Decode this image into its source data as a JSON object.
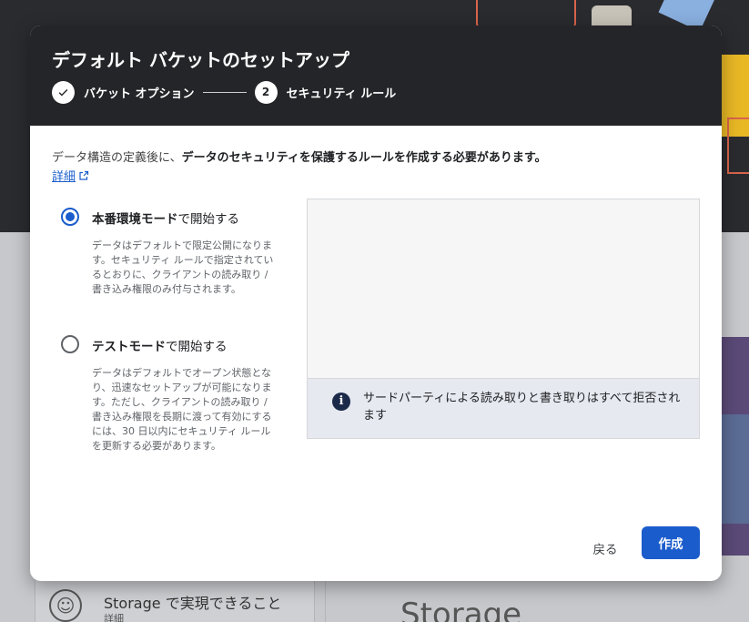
{
  "background": {
    "card_title": "Storage で実現できること",
    "card_link": "詳細",
    "storage_text": "Storage"
  },
  "dialog": {
    "title": "デフォルト バケットのセットアップ",
    "steps": [
      {
        "marker": "✓",
        "label": "バケット オプション",
        "state": "completed"
      },
      {
        "marker": "2",
        "label": "セキュリティ ルール",
        "state": "active"
      }
    ],
    "intro_prefix": "データ構造の定義後に、",
    "intro_bold": "データのセキュリティを保護するルールを作成する必要があります。",
    "learn_more": "詳細",
    "options": [
      {
        "title_bold": "本番環境モード",
        "title_rest": "で開始する",
        "description": "データはデフォルトで限定公開になります。セキュリティ ルールで指定されているとおりに、クライアントの読み取り / 書き込み権限のみ付与されます。",
        "selected": true
      },
      {
        "title_bold": "テストモード",
        "title_rest": "で開始する",
        "description": "データはデフォルトでオープン状態となり、迅速なセットアップが可能になります。ただし、クライアントの読み取り / 書き込み権限を長期に渡って有効にするには、30 日以内にセキュリティ ルールを更新する必要があります。",
        "selected": false
      }
    ],
    "info_text": "サードパーティによる読み取りと書き取りはすべて拒否されます",
    "back_label": "戻る",
    "create_label": "作成"
  },
  "colors": {
    "primary": "#1a5ccc",
    "header_bg": "#242528",
    "info_bg": "#e6e9f0"
  }
}
